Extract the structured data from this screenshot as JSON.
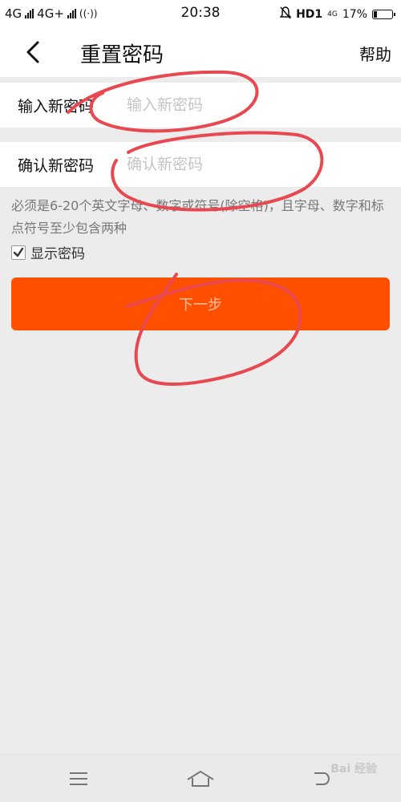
{
  "status_bar": {
    "signal_1": "4G",
    "signal_2": "4G+",
    "time": "20:38",
    "hd_label": "HD1",
    "network_small": "4G",
    "battery": "17%",
    "battery_level": 0.17
  },
  "nav": {
    "title": "重置密码",
    "help": "帮助",
    "back_icon": "chevron-left-icon"
  },
  "form": {
    "new_password_label": "输入新密码",
    "new_password_placeholder": "输入新密码",
    "new_password_value": "",
    "confirm_password_label": "确认新密码",
    "confirm_password_placeholder": "确认新密码",
    "confirm_password_value": "",
    "hint": "必须是6-20个英文字母、数字或符号(除空格)，且字母、数字和标点符号至少包含两种",
    "show_password_label": "显示密码",
    "show_password_checked": true,
    "next_button": "下一步"
  },
  "colors": {
    "accent": "#ff5000",
    "button_text": "#ffc2a6",
    "annotation": "#e8484f"
  },
  "system_nav": {
    "icons": [
      "menu-icon",
      "home-icon",
      "back-icon"
    ]
  },
  "watermark": "Bai 经验"
}
